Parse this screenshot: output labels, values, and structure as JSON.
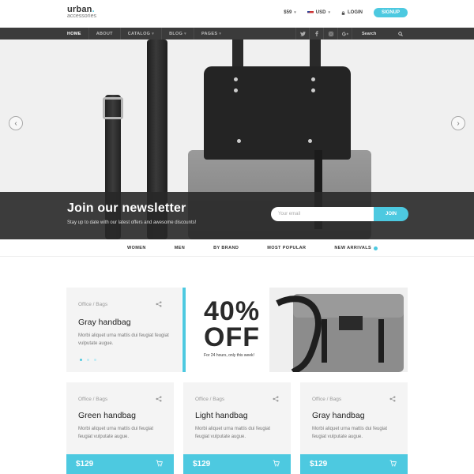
{
  "header": {
    "logo_main": "urban",
    "logo_dot": ".",
    "logo_sub": "accessories",
    "currency": "$59",
    "language": "USD",
    "login": "LOGIN",
    "signup": "SIGNUP"
  },
  "nav": {
    "items": [
      {
        "label": "HOME",
        "dropdown": false
      },
      {
        "label": "ABOUT",
        "dropdown": false
      },
      {
        "label": "CATALOG",
        "dropdown": true
      },
      {
        "label": "BLOG",
        "dropdown": true
      },
      {
        "label": "PAGES",
        "dropdown": true
      }
    ],
    "social_icons": [
      "twitter-icon",
      "facebook-icon",
      "instagram-icon",
      "google-plus-icon"
    ],
    "search_label": "Search"
  },
  "newsletter": {
    "title": "Join our newsletter",
    "subtitle": "Stay up to date with our latest offers and awesome discounts!",
    "email_placeholder": "Your email",
    "button": "JOIN"
  },
  "categories": [
    "WOMEN",
    "MEN",
    "BY BRAND",
    "MOST POPULAR",
    "NEW ARRIVALS"
  ],
  "featured": {
    "crumb": "Office / Bags",
    "title": "Gray handbag",
    "description": "Morbi aliquet urna mattis dui feugiat feugiat vulputate augue.",
    "promo_big_1": "40%",
    "promo_big_2": "OFF",
    "promo_small": "For 24 hours, only this week!"
  },
  "products": [
    {
      "crumb": "Office / Bags",
      "title": "Green handbag",
      "description": "Morbi aliquet urna mattis dui feugiat feugiat vulputate augue.",
      "price": "$129"
    },
    {
      "crumb": "Office / Bags",
      "title": "Light handbag",
      "description": "Morbi aliquet urna mattis dui feugiat feugiat vulputate augue.",
      "price": "$129"
    },
    {
      "crumb": "Office / Bags",
      "title": "Gray handbag",
      "description": "Morbi aliquet urna mattis dui feugiat feugiat vulputate augue.",
      "price": "$129"
    }
  ],
  "colors": {
    "accent": "#4dc9e0",
    "nav_bg": "#3b3b3b",
    "card_bg": "#f4f4f4"
  }
}
